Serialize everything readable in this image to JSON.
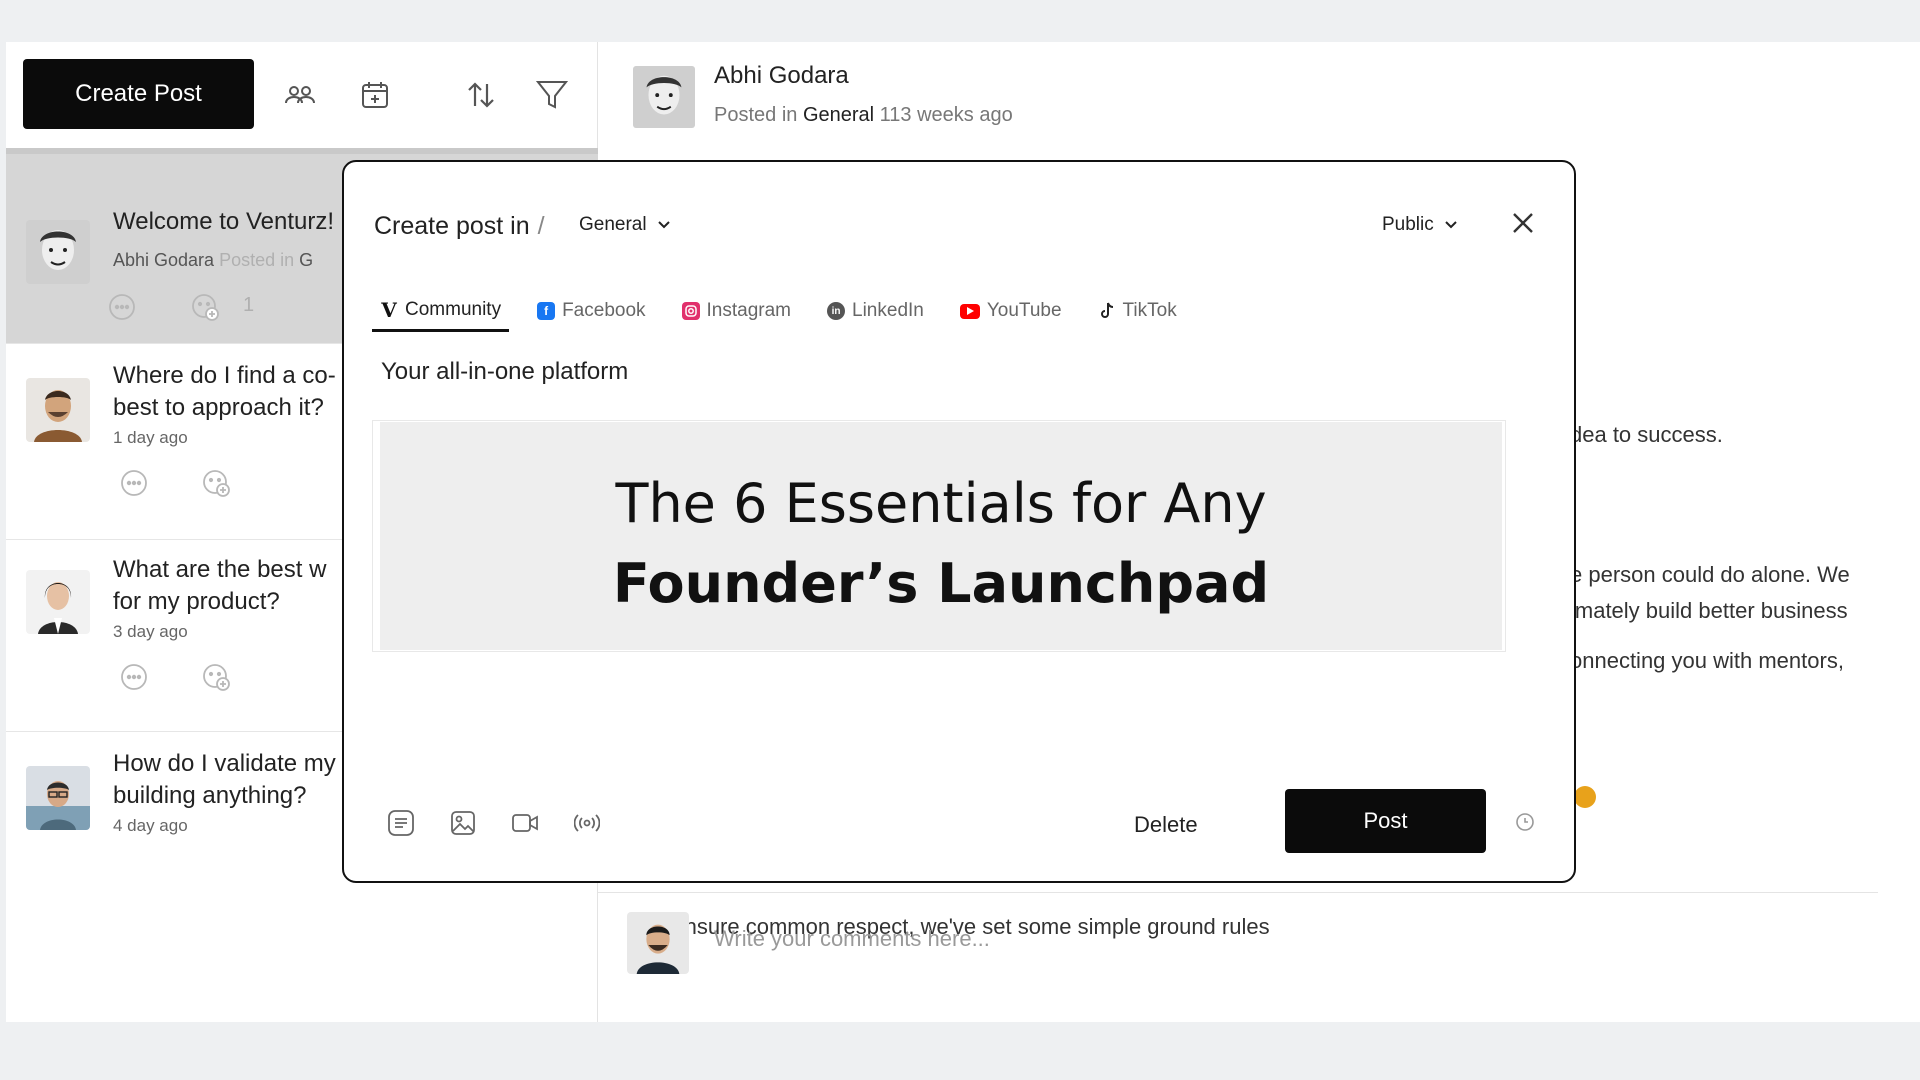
{
  "toolbar": {
    "create_post_label": "Create Post"
  },
  "feed": [
    {
      "title": "Welcome to Venturz!",
      "author": "Abhi Godara",
      "posted_in": "Posted in",
      "category_initial": "G",
      "reaction_count": "1"
    },
    {
      "title": "Where do I find a co-",
      "title_line2": "best to approach it?",
      "time": "1 day ago"
    },
    {
      "title": "What are the best w",
      "title_line2": "for my product?",
      "time": "3 day ago"
    },
    {
      "title": "How do I validate my",
      "title_line2": "building anything?",
      "time": "4  day ago"
    }
  ],
  "detail": {
    "author": "Abhi Godara",
    "posted_in": "Posted in",
    "category": "General",
    "age": "113 weeks ago",
    "text_fragments": [
      "dea to success.",
      "e person could do alone. We",
      "imately build better business",
      "onnecting you with mentors,"
    ],
    "partial_line": "To ensure common respect, we've set some simple ground rules",
    "comment_placeholder": "Write your comments here..."
  },
  "modal": {
    "title": "Create post in",
    "slash": "/",
    "category": "General",
    "visibility": "Public",
    "tabs": [
      {
        "label": "Community",
        "icon": "venturz-v-icon",
        "color": "#111111"
      },
      {
        "label": "Facebook",
        "icon": "facebook-icon",
        "color": "#1877f2"
      },
      {
        "label": "Instagram",
        "icon": "instagram-icon",
        "color": "#e1306c"
      },
      {
        "label": "LinkedIn",
        "icon": "linkedin-icon",
        "color": "#555555"
      },
      {
        "label": "YouTube",
        "icon": "youtube-icon",
        "color": "#ff0000"
      },
      {
        "label": "TikTok",
        "icon": "tiktok-icon",
        "color": "#222222"
      }
    ],
    "body_text": "Your all-in-one platform",
    "preview": {
      "line1": "The 6 Essentials for Any",
      "line2": "Founder’s Launchpad"
    },
    "delete_label": "Delete",
    "post_label": "Post"
  }
}
